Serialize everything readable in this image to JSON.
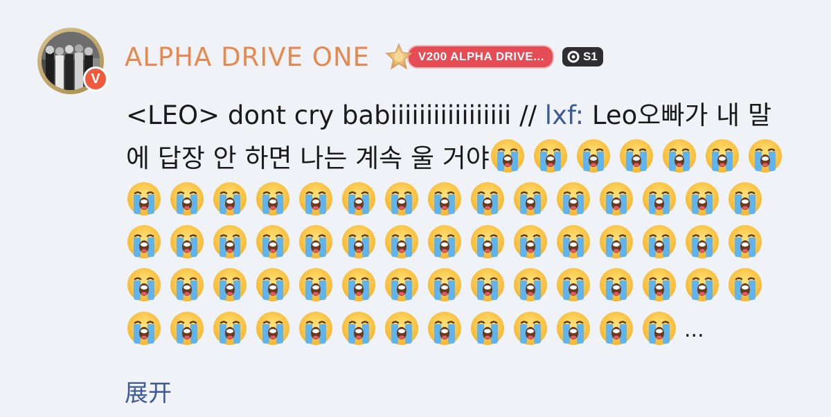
{
  "user": {
    "name": "ALPHA DRIVE ONE",
    "verified_label": "V",
    "fan_badge_label": "V200 ALPHA DRIVE...",
    "level_label": "S1"
  },
  "post": {
    "text_part1": "<LEO> dont cry babiiiiiiiiiiiiiiiii //",
    "mention": "lxf:",
    "text_part2": "Leo오빠가 내 말에 답장 안 하면 나는 계속 울 거야",
    "emoji_name": "loudly-crying-face-emoji",
    "emoji_count": 65,
    "ellipsis": "..."
  },
  "actions": {
    "expand_label": "展开"
  },
  "colors": {
    "background": "#eff2f6",
    "username": "#e7894f",
    "link": "#3e5a94",
    "fan_badge": "#e54c56",
    "verified": "#ef5a3c"
  }
}
